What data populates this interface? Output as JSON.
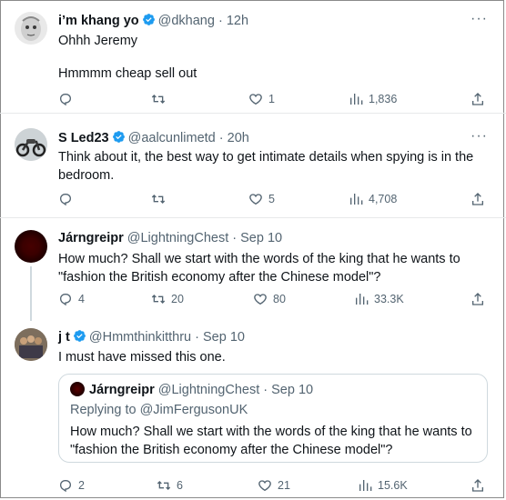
{
  "tweets": [
    {
      "name": "i’m khang yo",
      "handle": "@dkhang",
      "time": "12h",
      "verified": true,
      "lines": [
        "Ohhh Jeremy",
        "",
        "Hmmmm cheap sell out"
      ],
      "replies": "",
      "retweets": "",
      "likes": "1",
      "views": "1,836"
    },
    {
      "name": "S Led23",
      "handle": "@aalcunlimetd",
      "time": "20h",
      "verified": true,
      "lines": [
        "Think about it, the best way to get intimate details when spying is in the",
        "bedroom."
      ],
      "replies": "",
      "retweets": "",
      "likes": "5",
      "views": "4,708"
    },
    {
      "name": "Járngreipr",
      "handle": "@LightningChest",
      "time": "Sep 10",
      "verified": false,
      "lines": [
        "How much? Shall we start with the words of the king that he wants to",
        "\"fashion the British economy after the Chinese model\"?"
      ],
      "replies": "4",
      "retweets": "20",
      "likes": "80",
      "views": "33.3K"
    },
    {
      "name": "j t",
      "handle": "@Hmmthinkitthru",
      "time": "Sep 10",
      "verified": true,
      "lines": [
        "I must have missed this one."
      ],
      "replies": "2",
      "retweets": "6",
      "likes": "21",
      "views": "15.6K",
      "quote": {
        "name": "Járngreipr",
        "handle": "@LightningChest",
        "time": "Sep 10",
        "replying_to": "Replying to @JimFergusonUK",
        "lines": [
          "How much? Shall we start with the words of the king that he wants to",
          "\"fashion the British economy after the Chinese model\"?"
        ]
      }
    }
  ],
  "ui": {
    "dot": "·",
    "more": "···",
    "accent_color": "#1d9bf0",
    "muted_color": "#536471"
  }
}
